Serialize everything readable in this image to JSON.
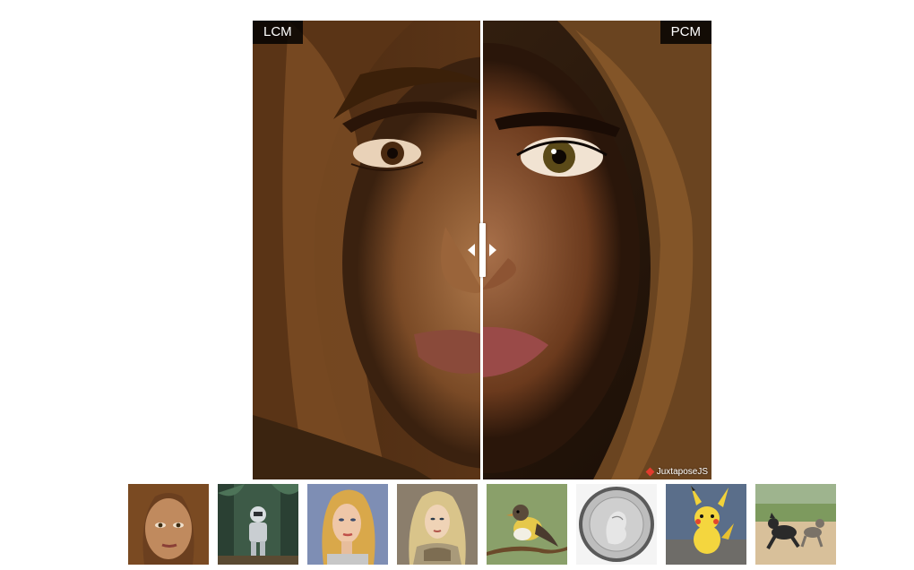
{
  "comparison": {
    "left_label": "LCM",
    "right_label": "PCM",
    "credit": "JuxtaposeJS",
    "handle_icon": "slider-handle-icon"
  },
  "colors": {
    "label_bg": "#000000",
    "divider": "#ffffff",
    "credit_diamond": "#e23b2d"
  },
  "thumbnails": [
    {
      "subject": "woman-headscarf-thumbnail"
    },
    {
      "subject": "astronaut-forest-thumbnail"
    },
    {
      "subject": "blonde-woman-thumbnail"
    },
    {
      "subject": "elf-warrior-thumbnail"
    },
    {
      "subject": "bird-on-branch-thumbnail"
    },
    {
      "subject": "silver-coin-thumbnail"
    },
    {
      "subject": "pikachu-thumbnail"
    },
    {
      "subject": "dog-and-cat-running-thumbnail"
    }
  ]
}
